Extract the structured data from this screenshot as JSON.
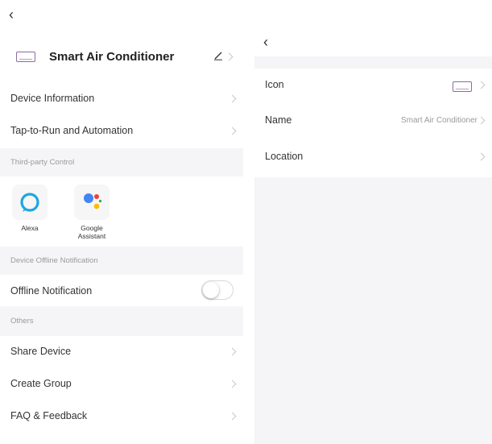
{
  "left": {
    "device_title": "Smart Air Conditioner",
    "rows_top": [
      {
        "label": "Device Information"
      },
      {
        "label": "Tap-to-Run and Automation"
      }
    ],
    "third_party_section": "Third-party Control",
    "third_party": [
      {
        "label": "Alexa",
        "icon": "alexa-icon"
      },
      {
        "label": "Google\nAssistant",
        "icon": "google-assistant-icon"
      }
    ],
    "offline_section": "Device Offline Notification",
    "offline_row": {
      "label": "Offline Notification",
      "enabled": false
    },
    "others_section": "Others",
    "rows_others": [
      {
        "label": "Share Device"
      },
      {
        "label": "Create Group"
      },
      {
        "label": "FAQ & Feedback"
      }
    ]
  },
  "right": {
    "rows": [
      {
        "label": "Icon",
        "value": ""
      },
      {
        "label": "Name",
        "value": "Smart Air Conditioner"
      },
      {
        "label": "Location",
        "value": ""
      }
    ]
  },
  "colors": {
    "section_bg": "#f5f5f7",
    "alexa": "#1ea7e1",
    "google_blue": "#4285f4",
    "google_red": "#ea4335",
    "google_yellow": "#fbbc05",
    "google_green": "#34a853",
    "device_icon": "#8e6aa0"
  }
}
